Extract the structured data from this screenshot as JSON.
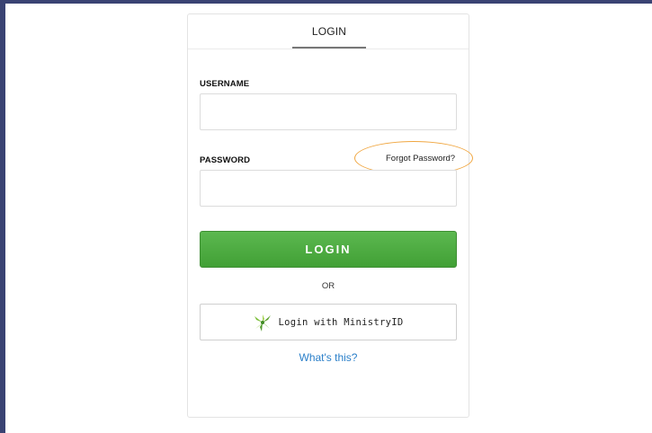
{
  "login_card": {
    "tab_label": "LOGIN",
    "username_label": "USERNAME",
    "username_value": "",
    "password_label": "PASSWORD",
    "password_value": "",
    "forgot_password": "Forgot Password?",
    "login_button": "LOGIN",
    "or_text": "OR",
    "ministry_button": "Login with MinistryID",
    "ministry_icon": "ministryid-logo-icon",
    "whats_this": "What's this?"
  },
  "colors": {
    "frame": "#3a4373",
    "login_button": "#4caf45",
    "link": "#2a7fc9",
    "highlight": "#f0a640"
  }
}
